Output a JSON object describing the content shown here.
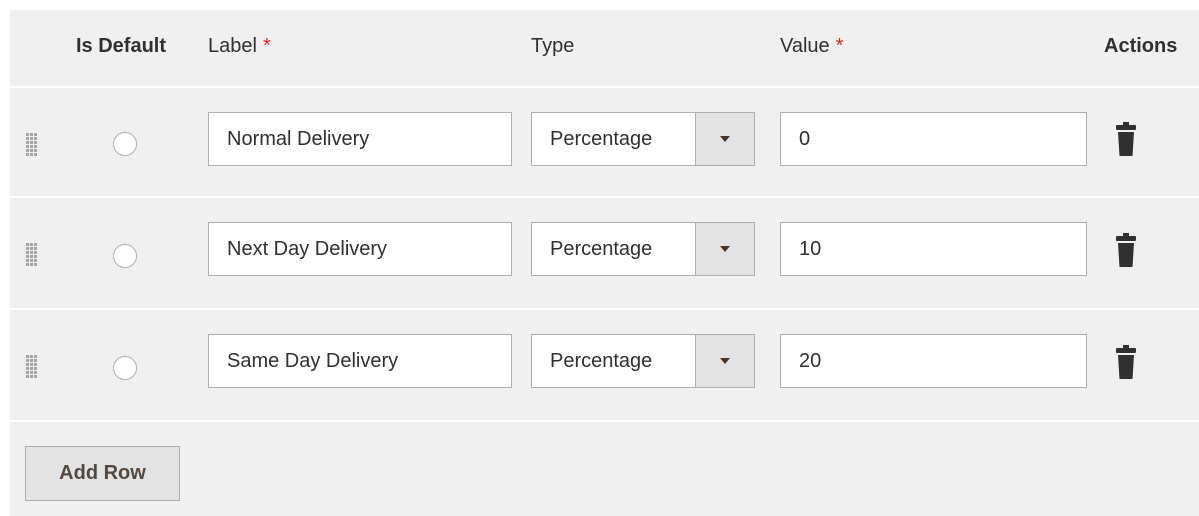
{
  "header": {
    "is_default": "Is Default",
    "label": "Label",
    "type": "Type",
    "value": "Value",
    "actions": "Actions",
    "required_marker": "*"
  },
  "rows": [
    {
      "label": "Normal Delivery",
      "type": "Percentage",
      "value": "0",
      "is_default": false
    },
    {
      "label": "Next Day Delivery",
      "type": "Percentage",
      "value": "10",
      "is_default": false
    },
    {
      "label": "Same Day Delivery",
      "type": "Percentage",
      "value": "20",
      "is_default": false
    }
  ],
  "add_row_label": "Add Row",
  "icons": {
    "drag": "drag-handle-icon",
    "delete": "trash-icon",
    "dropdown": "chevron-down-icon"
  },
  "colors": {
    "grid_background": "#f0f0f0",
    "required": "#e22626",
    "button_background": "#e3e3e3"
  }
}
